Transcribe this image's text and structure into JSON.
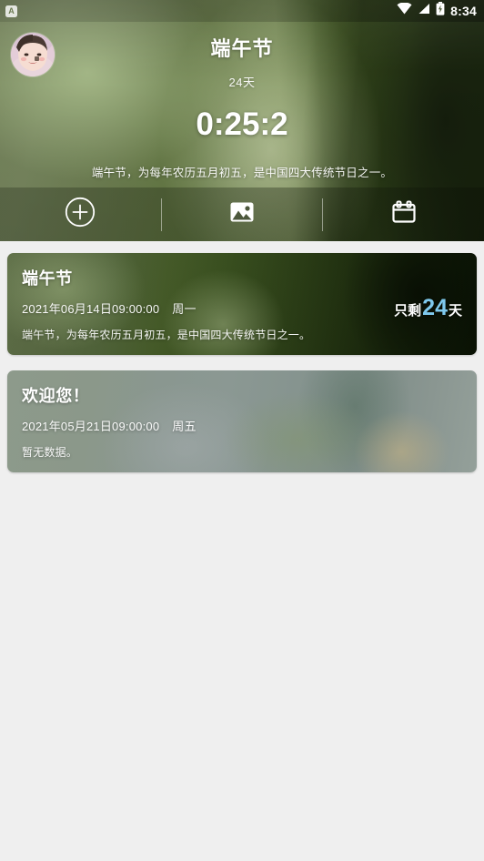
{
  "statusbar": {
    "notification_icon": "app-letter-icon",
    "notification_letter": "A",
    "wifi_icon": "wifi-icon",
    "signal_icon": "signal-icon",
    "battery_icon": "battery-charging-icon",
    "time": "8:34"
  },
  "hero": {
    "avatar_icon": "avatar",
    "title": "端午节",
    "days_label": "24天",
    "countdown": "0:25:2",
    "description": "端午节，为每年农历五月初五，是中国四大传统节日之一。"
  },
  "toolbar": {
    "items": [
      {
        "name": "add-button",
        "icon": "plus-circle-icon"
      },
      {
        "name": "gallery-button",
        "icon": "image-icon"
      },
      {
        "name": "calendar-button",
        "icon": "calendar-icon"
      }
    ]
  },
  "colors": {
    "accent_number": "#7fc9ed",
    "page_background": "#efefef",
    "text_primary": "#ffffff"
  },
  "cards": [
    {
      "title": "端午节",
      "date": "2021年06月14日09:00:00",
      "weekday": "周一",
      "description": "端午节，为每年农历五月初五，是中国四大传统节日之一。",
      "remain_prefix": "只剩",
      "remain_number": "24",
      "remain_suffix": "天"
    },
    {
      "title": "欢迎您！",
      "date": "2021年05月21日09:00:00",
      "weekday": "周五",
      "description": "暂无数据。",
      "remain_prefix": "",
      "remain_number": "",
      "remain_suffix": ""
    }
  ]
}
